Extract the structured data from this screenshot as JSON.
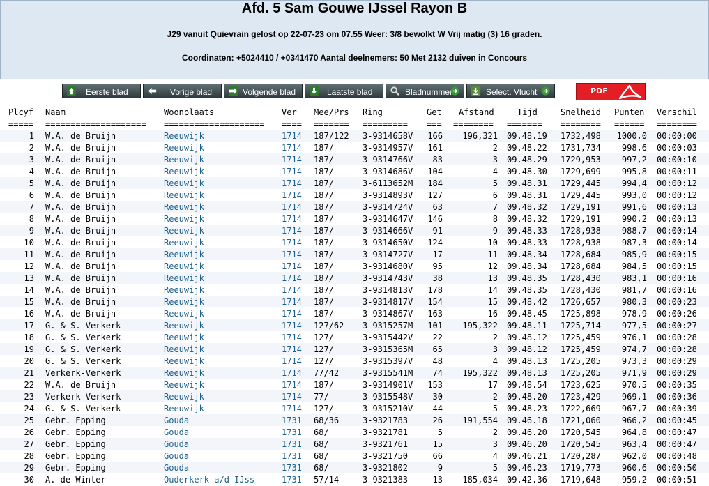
{
  "header": {
    "title": "Afd. 5 Sam Gouwe IJssel Rayon B",
    "subtitle": "J29 vanuit Quievrain gelost op 22-07-23 om 07.55 Weer: 3/8 bewolkt W Vrij matig (3) 16 graden.",
    "coordinates": "Coordinaten: +5024410 / +0341470 Aantal deelnemers: 50 Met 2132 duiven in Concours"
  },
  "toolbar": {
    "first": "Eerste blad",
    "prev": "Vorige blad",
    "next": "Volgende blad",
    "last": "Laatste blad",
    "page": "Bladnummer",
    "flight": "Select. Vlucht",
    "pdf": "PDF"
  },
  "colors": {
    "link": "#1b5e8c",
    "header_bg": "#dde8f2",
    "button": "#3f4d50",
    "pdf": "#e31e24"
  },
  "table": {
    "headers": [
      "Plcyf",
      "Naam",
      "Woonplaats",
      "Ver",
      "Mee/Prs",
      "Ring",
      "Get",
      "Afstand",
      "Tijd",
      "Snelheid",
      "Punten",
      "Verschil"
    ],
    "separators": [
      "=====",
      "====================",
      "====================",
      "====",
      "=======",
      "=========",
      "===",
      "========",
      "=======",
      "========",
      "======",
      "========"
    ],
    "rows": [
      [
        "1",
        "W.A. de Bruijn",
        "Reeuwijk",
        "1714",
        "187/122",
        "3-9314658V",
        "166",
        "196,321",
        "09.48.19",
        "1732,498",
        "1000,0",
        "00:00:00"
      ],
      [
        "2",
        "W.A. de Bruijn",
        "Reeuwijk",
        "1714",
        "187/",
        "3-9314957V",
        "161",
        "2",
        "09.48.22",
        "1731,734",
        "998,6",
        "00:00:03"
      ],
      [
        "3",
        "W.A. de Bruijn",
        "Reeuwijk",
        "1714",
        "187/",
        "3-9314766V",
        "83",
        "3",
        "09.48.29",
        "1729,953",
        "997,2",
        "00:00:10"
      ],
      [
        "4",
        "W.A. de Bruijn",
        "Reeuwijk",
        "1714",
        "187/",
        "3-9314686V",
        "104",
        "4",
        "09.48.30",
        "1729,699",
        "995,8",
        "00:00:11"
      ],
      [
        "5",
        "W.A. de Bruijn",
        "Reeuwijk",
        "1714",
        "187/",
        "3-6113652M",
        "184",
        "5",
        "09.48.31",
        "1729,445",
        "994,4",
        "00:00:12"
      ],
      [
        "6",
        "W.A. de Bruijn",
        "Reeuwijk",
        "1714",
        "187/",
        "3-9314893V",
        "127",
        "6",
        "09.48.31",
        "1729,445",
        "993,0",
        "00:00:12"
      ],
      [
        "7",
        "W.A. de Bruijn",
        "Reeuwijk",
        "1714",
        "187/",
        "3-9314724V",
        "63",
        "7",
        "09.48.32",
        "1729,191",
        "991,6",
        "00:00:13"
      ],
      [
        "8",
        "W.A. de Bruijn",
        "Reeuwijk",
        "1714",
        "187/",
        "3-9314647V",
        "146",
        "8",
        "09.48.32",
        "1729,191",
        "990,2",
        "00:00:13"
      ],
      [
        "9",
        "W.A. de Bruijn",
        "Reeuwijk",
        "1714",
        "187/",
        "3-9314666V",
        "91",
        "9",
        "09.48.33",
        "1728,938",
        "988,7",
        "00:00:14"
      ],
      [
        "10",
        "W.A. de Bruijn",
        "Reeuwijk",
        "1714",
        "187/",
        "3-9314650V",
        "124",
        "10",
        "09.48.33",
        "1728,938",
        "987,3",
        "00:00:14"
      ],
      [
        "11",
        "W.A. de Bruijn",
        "Reeuwijk",
        "1714",
        "187/",
        "3-9314727V",
        "17",
        "11",
        "09.48.34",
        "1728,684",
        "985,9",
        "00:00:15"
      ],
      [
        "12",
        "W.A. de Bruijn",
        "Reeuwijk",
        "1714",
        "187/",
        "3-9314680V",
        "95",
        "12",
        "09.48.34",
        "1728,684",
        "984,5",
        "00:00:15"
      ],
      [
        "13",
        "W.A. de Bruijn",
        "Reeuwijk",
        "1714",
        "187/",
        "3-9314743V",
        "38",
        "13",
        "09.48.35",
        "1728,430",
        "983,1",
        "00:00:16"
      ],
      [
        "14",
        "W.A. de Bruijn",
        "Reeuwijk",
        "1714",
        "187/",
        "3-9314813V",
        "178",
        "14",
        "09.48.35",
        "1728,430",
        "981,7",
        "00:00:16"
      ],
      [
        "15",
        "W.A. de Bruijn",
        "Reeuwijk",
        "1714",
        "187/",
        "3-9314817V",
        "154",
        "15",
        "09.48.42",
        "1726,657",
        "980,3",
        "00:00:23"
      ],
      [
        "16",
        "W.A. de Bruijn",
        "Reeuwijk",
        "1714",
        "187/",
        "3-9314867V",
        "163",
        "16",
        "09.48.45",
        "1725,898",
        "978,9",
        "00:00:26"
      ],
      [
        "17",
        "G. & S. Verkerk",
        "Reeuwijk",
        "1714",
        "127/62",
        "3-9315257M",
        "101",
        "195,322",
        "09.48.11",
        "1725,714",
        "977,5",
        "00:00:27"
      ],
      [
        "18",
        "G. & S. Verkerk",
        "Reeuwijk",
        "1714",
        "127/",
        "3-9315442V",
        "22",
        "2",
        "09.48.12",
        "1725,459",
        "976,1",
        "00:00:28"
      ],
      [
        "19",
        "G. & S. Verkerk",
        "Reeuwijk",
        "1714",
        "127/",
        "3-9315365M",
        "65",
        "3",
        "09.48.12",
        "1725,459",
        "974,7",
        "00:00:28"
      ],
      [
        "20",
        "G. & S. Verkerk",
        "Reeuwijk",
        "1714",
        "127/",
        "3-9315397V",
        "48",
        "4",
        "09.48.13",
        "1725,205",
        "973,3",
        "00:00:29"
      ],
      [
        "21",
        "Verkerk-Verkerk",
        "Reeuwijk",
        "1714",
        "77/42",
        "3-9315541M",
        "74",
        "195,322",
        "09.48.13",
        "1725,205",
        "971,9",
        "00:00:29"
      ],
      [
        "22",
        "W.A. de Bruijn",
        "Reeuwijk",
        "1714",
        "187/",
        "3-9314901V",
        "153",
        "17",
        "09.48.54",
        "1723,625",
        "970,5",
        "00:00:35"
      ],
      [
        "23",
        "Verkerk-Verkerk",
        "Reeuwijk",
        "1714",
        "77/",
        "3-9315548V",
        "30",
        "2",
        "09.48.20",
        "1723,429",
        "969,1",
        "00:00:36"
      ],
      [
        "24",
        "G. & S. Verkerk",
        "Reeuwijk",
        "1714",
        "127/",
        "3-9315210V",
        "44",
        "5",
        "09.48.23",
        "1722,669",
        "967,7",
        "00:00:39"
      ],
      [
        "25",
        "Gebr. Epping",
        "Gouda",
        "1731",
        "68/36",
        "3-9321783",
        "26",
        "191,554",
        "09.46.18",
        "1721,060",
        "966,2",
        "00:00:45"
      ],
      [
        "26",
        "Gebr. Epping",
        "Gouda",
        "1731",
        "68/",
        "3-9321781",
        "5",
        "2",
        "09.46.20",
        "1720,545",
        "964,8",
        "00:00:47"
      ],
      [
        "27",
        "Gebr. Epping",
        "Gouda",
        "1731",
        "68/",
        "3-9321761",
        "15",
        "3",
        "09.46.20",
        "1720,545",
        "963,4",
        "00:00:47"
      ],
      [
        "28",
        "Gebr. Epping",
        "Gouda",
        "1731",
        "68/",
        "3-9321750",
        "66",
        "4",
        "09.46.21",
        "1720,287",
        "962,0",
        "00:00:48"
      ],
      [
        "29",
        "Gebr. Epping",
        "Gouda",
        "1731",
        "68/",
        "3-9321802",
        "9",
        "5",
        "09.46.23",
        "1719,773",
        "960,6",
        "00:00:50"
      ],
      [
        "30",
        "A. de Winter",
        "Ouderkerk a/d IJss",
        "1731",
        "57/14",
        "3-9321383",
        "13",
        "185,034",
        "09.42.36",
        "1719,648",
        "959,2",
        "00:00:51"
      ]
    ]
  }
}
